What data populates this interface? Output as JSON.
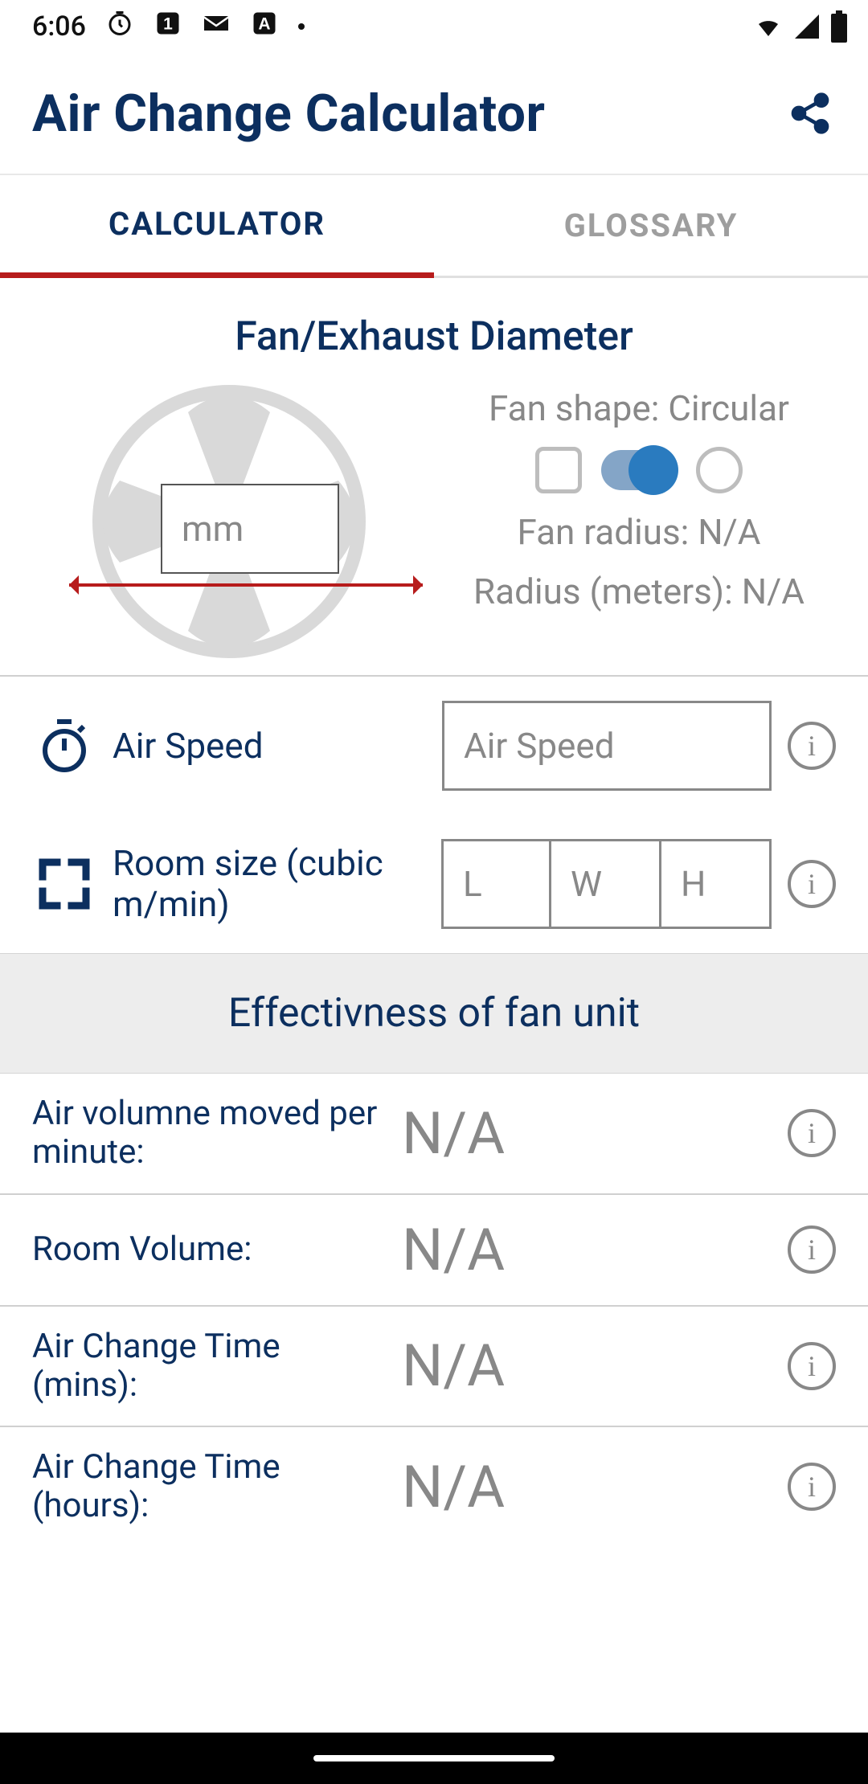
{
  "status": {
    "time": "6:06",
    "icons_left": [
      "clock-icon",
      "app1-icon",
      "mail-icon",
      "app2-icon",
      "dot-icon"
    ],
    "icons_right": [
      "wifi-icon",
      "signal-icon",
      "battery-icon"
    ]
  },
  "header": {
    "title": "Air Change Calculator"
  },
  "tabs": {
    "calculator": "CALCULATOR",
    "glossary": "GLOSSARY",
    "active": "calculator"
  },
  "fan": {
    "section_title": "Fan/Exhaust Diameter",
    "mm_placeholder": "mm",
    "shape_label": "Fan shape: Circular",
    "radius_label": "Fan radius: N/A",
    "radius_meters_label": "Radius (meters): N/A"
  },
  "inputs": {
    "air_speed": {
      "label": "Air Speed",
      "placeholder": "Air Speed"
    },
    "room_size": {
      "label": "Room size (cubic m/min)",
      "L": "L",
      "W": "W",
      "H": "H"
    }
  },
  "results": {
    "title": "Effectivness of fan unit",
    "rows": [
      {
        "label": "Air volumne moved per minute:",
        "value": "N/A"
      },
      {
        "label": "Room Volume:",
        "value": "N/A"
      },
      {
        "label": "Air Change Time (mins):",
        "value": "N/A"
      },
      {
        "label": "Air Change Time (hours):",
        "value": "N/A"
      }
    ]
  }
}
